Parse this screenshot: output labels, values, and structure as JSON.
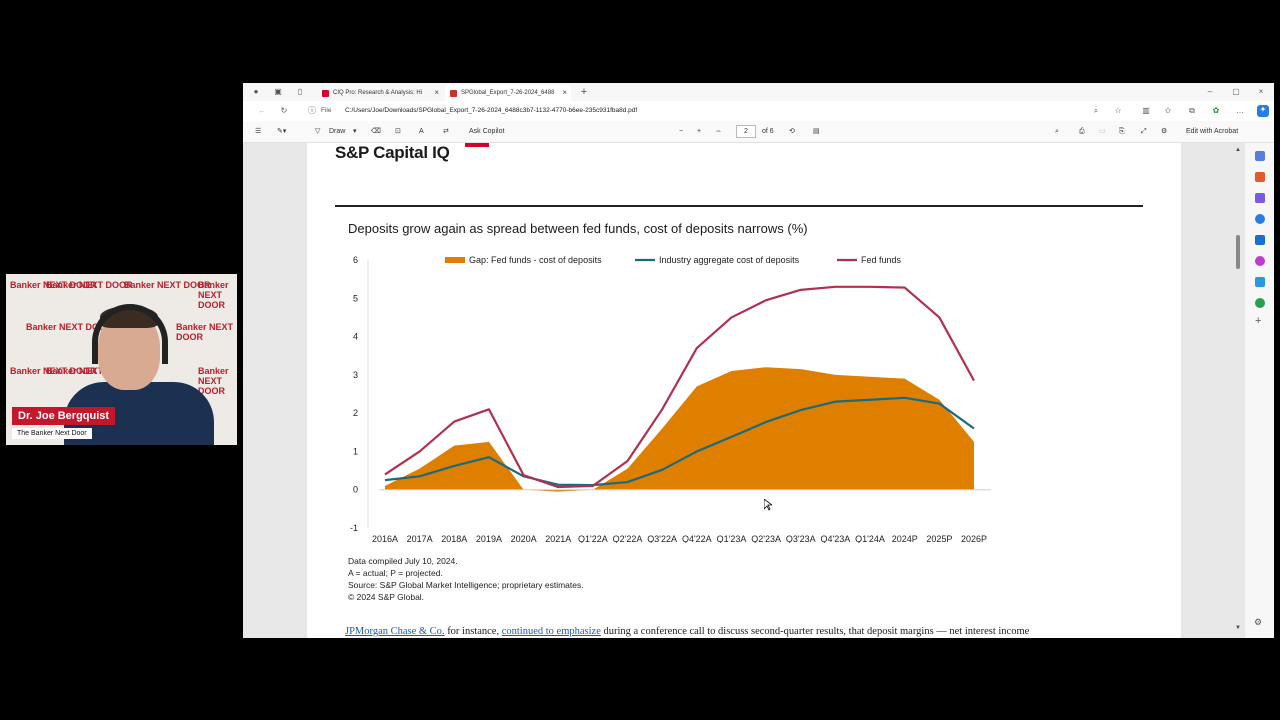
{
  "webcam": {
    "name": "Dr. Joe Bergquist",
    "subtitle": "The Banker Next Door",
    "backdrop_text": "Banker NEXT DOOR"
  },
  "browser": {
    "tabs": [
      {
        "label": "CIQ Pro: Research & Analysis: Hi",
        "active": false,
        "favicon_color": "#d6002a"
      },
      {
        "label": "SPGlobal_Export_7-26-2024_6488",
        "active": true,
        "favicon_color": "#c8322c"
      }
    ],
    "new_tab": "+",
    "address_scheme": "File",
    "address": "C:/Users/Joe/Downloads/SPGlobal_Export_7-26-2024_6488c3b7-1132-4770-b6ee-235c931fba8d.pdf",
    "pdf_toolbar": {
      "draw": "Draw",
      "ask_copilot": "Ask Copilot",
      "zoom_out": "−",
      "zoom_in": "+",
      "page_current": "2",
      "page_of": "of 6",
      "edit_acrobat": "Edit with Acrobat"
    }
  },
  "pdf": {
    "brand": "S&P Capital IQ",
    "chart_title": "Deposits grow again as spread between fed funds, cost of deposits narrows (%)",
    "notes": [
      "Data compiled July 10, 2024.",
      "A = actual; P = projected.",
      "Source: S&P Global Market Intelligence; proprietary estimates.",
      "© 2024 S&P Global."
    ],
    "paragraph": {
      "link1": "JPMorgan Chase & Co.",
      "text1": " for instance, ",
      "link2": "continued to emphasize",
      "text2": " during a conference call to discuss second-quarter results, that deposit margins — net interest income"
    }
  },
  "chart_data": {
    "type": "area",
    "title": "Deposits grow again as spread between fed funds, cost of deposits narrows (%)",
    "categories": [
      "2016A",
      "2017A",
      "2018A",
      "2019A",
      "2020A",
      "2021A",
      "Q1'22A",
      "Q2'22A",
      "Q3'22A",
      "Q4'22A",
      "Q1'23A",
      "Q2'23A",
      "Q3'23A",
      "Q4'23A",
      "Q1'24A",
      "2024P",
      "2025P",
      "2026P"
    ],
    "ylim": [
      -1,
      6
    ],
    "yticks": [
      -1,
      0,
      1,
      2,
      3,
      4,
      5,
      6
    ],
    "legend_position": "top",
    "grid": false,
    "series": [
      {
        "name": "Gap: Fed funds - cost of deposits",
        "kind": "area",
        "color": "#df7f00",
        "values": [
          0.1,
          0.55,
          1.15,
          1.25,
          0.0,
          -0.05,
          0.0,
          0.55,
          1.6,
          2.7,
          3.1,
          3.2,
          3.15,
          3.0,
          2.95,
          2.9,
          2.35,
          1.25
        ]
      },
      {
        "name": "Industry aggregate cost of deposits",
        "kind": "line",
        "color": "#1b6a7d",
        "values": [
          0.25,
          0.35,
          0.62,
          0.85,
          0.35,
          0.13,
          0.12,
          0.2,
          0.52,
          1.0,
          1.38,
          1.77,
          2.08,
          2.3,
          2.35,
          2.4,
          2.25,
          1.6
        ]
      },
      {
        "name": "Fed funds",
        "kind": "line",
        "color": "#b03050",
        "values": [
          0.4,
          1.0,
          1.78,
          2.1,
          0.38,
          0.07,
          0.1,
          0.75,
          2.1,
          3.7,
          4.5,
          4.95,
          5.22,
          5.3,
          5.3,
          5.28,
          4.5,
          2.85
        ]
      }
    ]
  }
}
